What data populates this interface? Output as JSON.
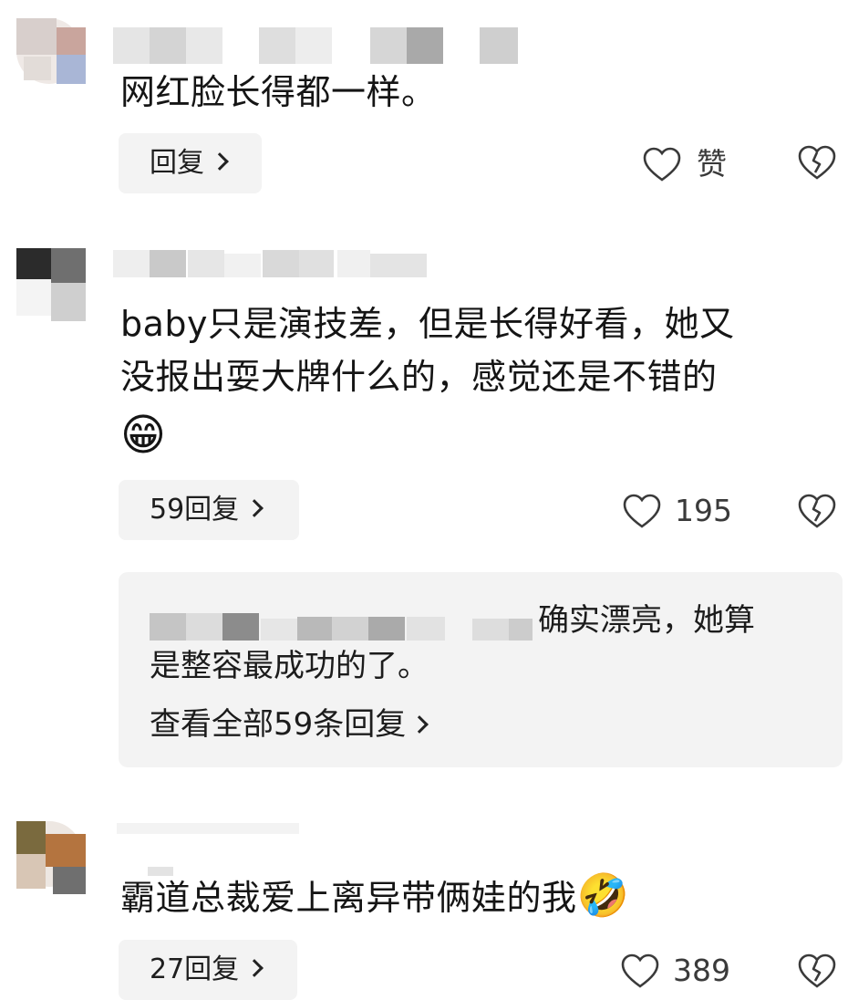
{
  "comments": [
    {
      "text_lines": [
        "网红脸长得都一样。"
      ],
      "reply_label": "回复",
      "like_label": "赞"
    },
    {
      "text_lines": [
        "baby只是演技差，但是长得好看，她又",
        "没报出耍大牌什么的，感觉还是不错的"
      ],
      "emoji": "😁",
      "reply_label": "59回复",
      "like_label": "195",
      "sub_reply": {
        "visible_text": "确实漂亮，她算",
        "second_line": "是整容最成功的了。",
        "view_all_label": "查看全部59条回复"
      }
    },
    {
      "text_lines": [
        "霸道总裁爱上离异带俩娃的我"
      ],
      "emoji": "🤣",
      "reply_label": "27回复",
      "like_label": "389"
    }
  ],
  "icons": {
    "like": "heart-outline-icon",
    "dislike": "broken-heart-icon",
    "reply_arrow": "chevron-right-icon"
  },
  "colors": {
    "reply_button_bg": "#f3f3f3",
    "text": "#151515",
    "icon": "#3a3a3a"
  }
}
